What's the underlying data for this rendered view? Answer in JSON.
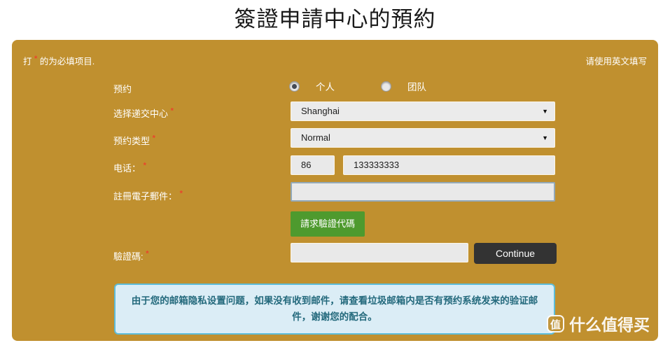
{
  "page": {
    "title": "簽證申請中心的預約"
  },
  "card": {
    "required_note_prefix": "打",
    "required_note_star": "*",
    "required_note_suffix": "的为必填项目.",
    "english_note": "请使用英文填写",
    "background_color": "#c0902f"
  },
  "form": {
    "appointment": {
      "label": "预约",
      "options": [
        {
          "label": "个人",
          "selected": true
        },
        {
          "label": "团队",
          "selected": false
        }
      ]
    },
    "center": {
      "label": "选择递交中心",
      "required": "*",
      "value": "Shanghai",
      "arrow": "chevron-down-icon"
    },
    "appointment_type": {
      "label": "预约类型",
      "required": "*",
      "value": "Normal",
      "arrow": "chevron-down-icon"
    },
    "phone": {
      "label": "电话：",
      "required": "*",
      "country_code": "86",
      "number": "133333333"
    },
    "email": {
      "label": "註冊電子郵件：",
      "required": "*",
      "value": "",
      "focused": true
    },
    "request_code_button": {
      "label": "請求驗證代碼",
      "color": "#4e9a2e"
    },
    "captcha": {
      "label": "驗證碼:",
      "required": "*",
      "value": ""
    },
    "continue_button": {
      "label": "Continue",
      "color": "#333333"
    }
  },
  "alert": {
    "text": "由于您的邮箱隐私设置问题，如果没有收到邮件，请查看垃圾邮箱内是否有预约系统发来的验证邮件，谢谢您的配合。",
    "background_color": "#dbedf6",
    "border_color": "#5dbcd8",
    "text_color": "#23697c"
  },
  "watermark": {
    "badge": "值",
    "text": "什么值得买"
  }
}
